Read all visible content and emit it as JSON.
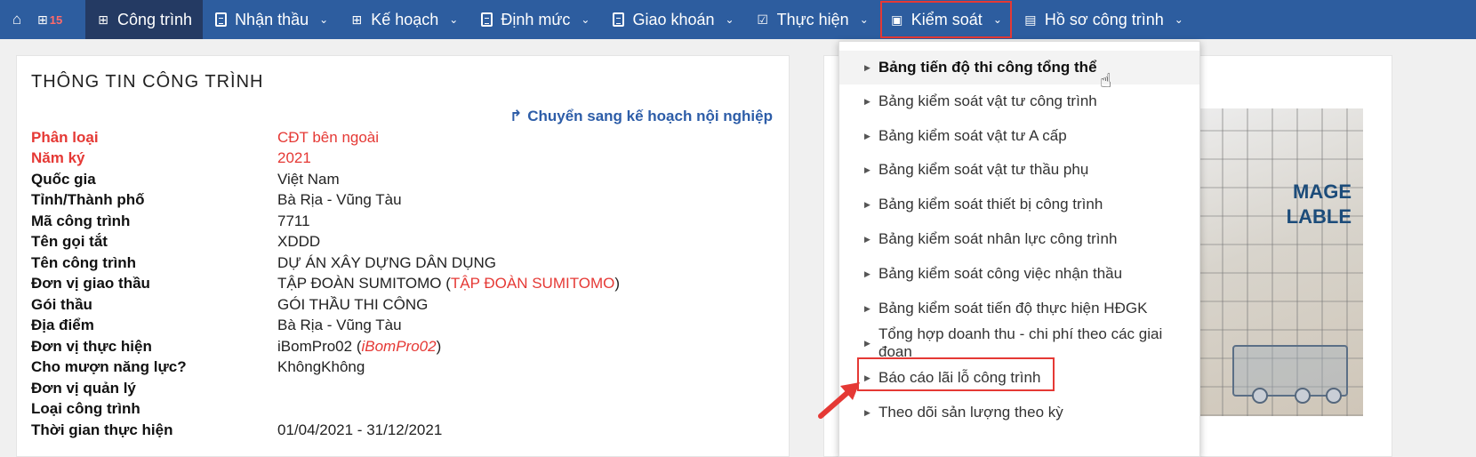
{
  "nav": {
    "badge": "15",
    "items": [
      {
        "label": "Công trình",
        "icon": "grid-icon"
      },
      {
        "label": "Nhận thầu",
        "icon": "document-icon"
      },
      {
        "label": "Kế hoạch",
        "icon": "grid-icon"
      },
      {
        "label": "Định mức",
        "icon": "document-icon"
      },
      {
        "label": "Giao khoán",
        "icon": "document-icon"
      },
      {
        "label": "Thực hiện",
        "icon": "checkbox-icon"
      },
      {
        "label": "Kiểm soát",
        "icon": "monitor-icon"
      },
      {
        "label": "Hồ sơ công trình",
        "icon": "briefcase-icon"
      }
    ]
  },
  "info": {
    "title": "THÔNG TIN CÔNG TRÌNH",
    "move_link": "Chuyển sang kế hoạch nội nghiệp",
    "rows": [
      {
        "label": "Phân loại",
        "value": "CĐT bên ngoài"
      },
      {
        "label": "Năm ký",
        "value": "2021"
      },
      {
        "label": "Quốc gia",
        "value": "Việt Nam"
      },
      {
        "label": "Tỉnh/Thành phố",
        "value": "Bà Rịa - Vũng Tàu"
      },
      {
        "label": "Mã công trình",
        "value": "7711"
      },
      {
        "label": "Tên gọi tắt",
        "value": "XDDD"
      },
      {
        "label": "Tên công trình",
        "value": "DỰ ÁN XÂY DỰNG DÂN DỤNG"
      },
      {
        "label": "Đơn vị giao thầu",
        "value": "TẬP ĐOÀN SUMITOMO (",
        "sub": "TẬP ĐOÀN SUMITOMO",
        "close": ")"
      },
      {
        "label": "Gói thầu",
        "value": "GÓI THẦU THI CÔNG"
      },
      {
        "label": "Địa điểm",
        "value": "Bà Rịa - Vũng Tàu"
      },
      {
        "label": "Đơn vị thực hiện",
        "value": "iBomPro02 (",
        "sub": "iBomPro02",
        "close": ")"
      },
      {
        "label": "Cho mượn năng lực?",
        "value": "KhôngKhông"
      },
      {
        "label": "Đơn vị quản lý",
        "value": ""
      },
      {
        "label": "Loại công trình",
        "value": ""
      },
      {
        "label": "Thời gian thực hiện",
        "value": "01/04/2021 - 31/12/2021"
      }
    ]
  },
  "image_text": {
    "line1": "MAGE",
    "line2": "LABLE"
  },
  "dropdown": {
    "items": [
      "Bảng tiến độ thi công tổng thể",
      "Bảng kiểm soát vật tư công trình",
      "Bảng kiểm soát vật tư A cấp",
      "Bảng kiểm soát vật tư thầu phụ",
      "Bảng kiểm soát thiết bị công trình",
      "Bảng kiểm soát nhân lực công trình",
      "Bảng kiểm soát công việc nhận thầu",
      "Bảng kiểm soát tiến độ thực hiện HĐGK",
      "Tổng hợp doanh thu - chi phí theo các giai đoạn",
      "Báo cáo lãi lỗ công trình",
      "Theo dõi sản lượng theo kỳ"
    ]
  },
  "colors": {
    "nav_bg": "#2d5d9f",
    "nav_active": "#243a63",
    "highlight": "#e53935",
    "link": "#2d5da8"
  }
}
